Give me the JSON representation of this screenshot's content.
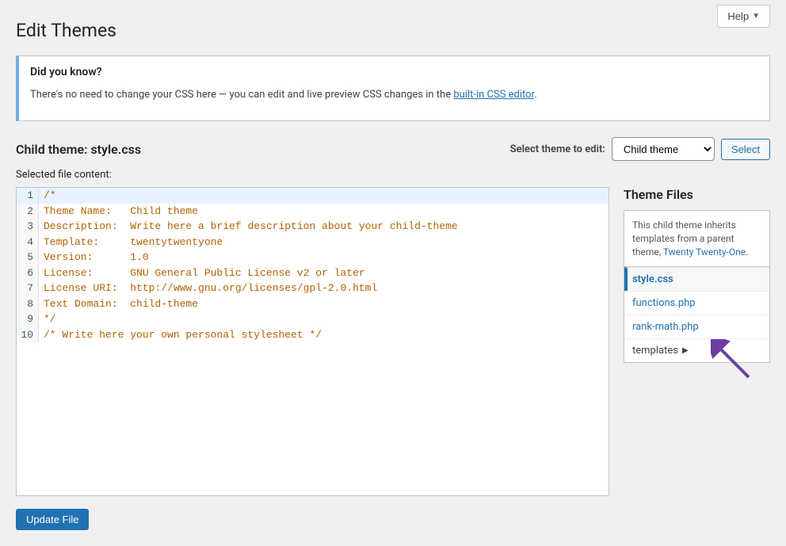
{
  "help_label": "Help",
  "page_title": "Edit Themes",
  "notice": {
    "title": "Did you know?",
    "body_prefix": "There's no need to change your CSS here — you can edit and live preview CSS changes in the ",
    "link_text": "built-in CSS editor",
    "body_suffix": "."
  },
  "file_heading_prefix": "Child theme: ",
  "file_name": "style.css",
  "select_label": "Select theme to edit:",
  "select_value": "Child theme",
  "select_button": "Select",
  "selected_file_label": "Selected file content:",
  "code_lines": [
    "/*",
    "Theme Name:   Child theme",
    "Description:  Write here a brief description about your child-theme",
    "Template:     twentytwentyone",
    "Version:      1.0",
    "License:      GNU General Public License v2 or later",
    "License URI:  http://www.gnu.org/licenses/gpl-2.0.html",
    "Text Domain:  child-theme",
    "*/",
    "/* Write here your own personal stylesheet */"
  ],
  "sidebar": {
    "heading": "Theme Files",
    "desc_prefix": "This child theme inherits templates from a parent theme, ",
    "desc_link": "Twenty Twenty-One",
    "desc_suffix": ".",
    "files": [
      "style.css",
      "functions.php",
      "rank-math.php",
      "templates"
    ]
  },
  "update_button": "Update File"
}
